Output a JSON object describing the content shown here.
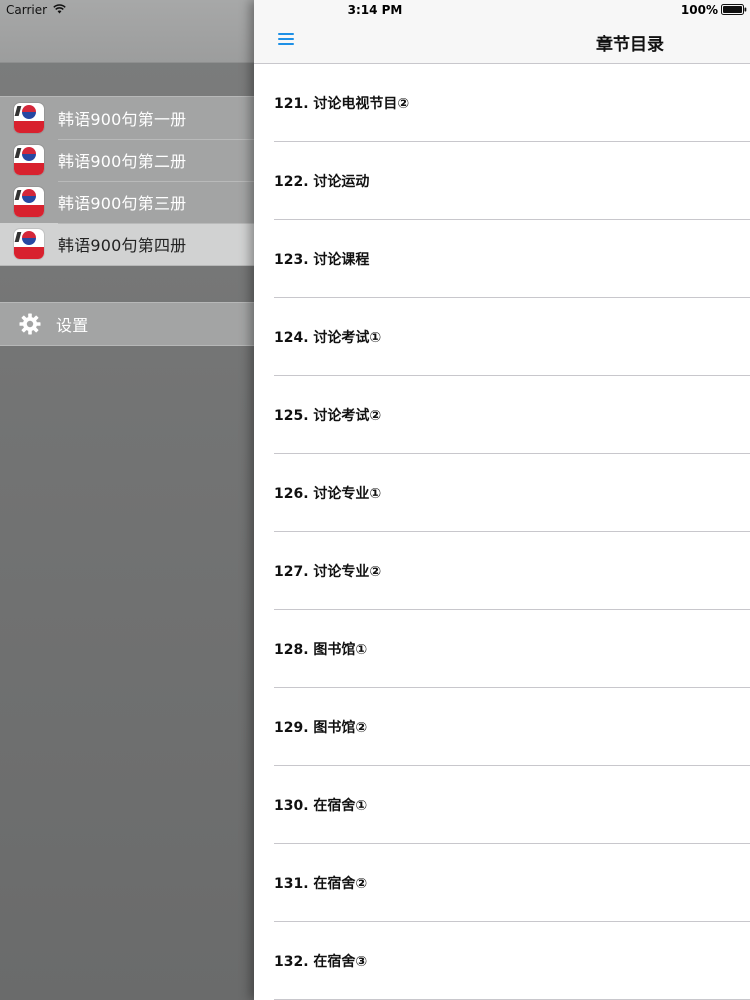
{
  "status_bar": {
    "carrier": "Carrier",
    "time": "3:14 PM",
    "battery": "100%"
  },
  "side_menu": {
    "books": [
      {
        "label": "韩语900句第一册"
      },
      {
        "label": "韩语900句第二册"
      },
      {
        "label": "韩语900句第三册"
      },
      {
        "label": "韩语900句第四册"
      }
    ],
    "selected_index": 3,
    "settings_label": "设置"
  },
  "main": {
    "title": "章节目录",
    "chapters": [
      {
        "label": "121. 讨论电视节目②"
      },
      {
        "label": "122. 讨论运动"
      },
      {
        "label": "123. 讨论课程"
      },
      {
        "label": "124. 讨论考试①"
      },
      {
        "label": "125. 讨论考试②"
      },
      {
        "label": "126. 讨论专业①"
      },
      {
        "label": "127. 讨论专业②"
      },
      {
        "label": "128. 图书馆①"
      },
      {
        "label": "129. 图书馆②"
      },
      {
        "label": "130. 在宿舍①"
      },
      {
        "label": "131. 在宿舍②"
      },
      {
        "label": "132. 在宿舍③"
      }
    ]
  },
  "colors": {
    "accent": "#1e90e6",
    "menu_background": "#737474",
    "selected_row": "#d1d2d2"
  },
  "icons": {
    "menu": "hamburger-icon",
    "settings": "gear-icon",
    "book": "app-icon",
    "wifi": "wifi-icon",
    "battery": "battery-icon"
  }
}
